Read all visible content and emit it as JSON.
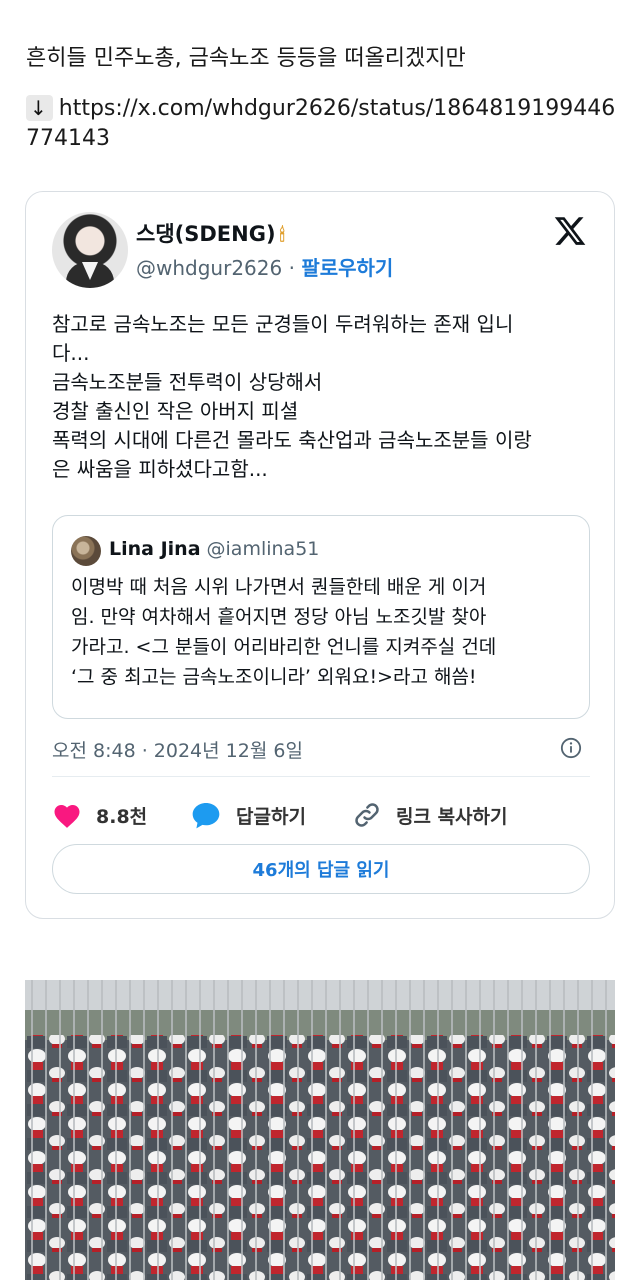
{
  "intro_text": "흔히들 민주노총, 금속노조 등등을 떠올리겠지만",
  "link": {
    "arrow": "↓",
    "url": "https://x.com/whdgur2626/status/1864819199446774143"
  },
  "tweet": {
    "name": "스댕(SDENG)",
    "name_emoji": "🕯",
    "handle": "@whdgur2626",
    "separator": "·",
    "follow_label": "팔로우하기",
    "logo": "x-logo-icon",
    "text_lines": [
      "참고로 금속노조는 모든 군경들이 두려워하는 존재 입니",
      "다...",
      "금속노조분들 전투력이 상당해서",
      "경찰 출신인 작은 아버지 피셜",
      "폭력의 시대에 다른건 몰라도 축산업과 금속노조분들 이랑",
      "은 싸움을 피하셨다고함..."
    ],
    "quote": {
      "name": "Lina Jina",
      "handle": "@iamlina51",
      "text_lines": [
        "이명박 때 처음 시위 나가면서 퀀들한테 배운 게 이거",
        "임. 만약 여차해서 흩어지면 정당 아님 노조깃발 찾아",
        "가라고. <그 분들이 어리바리한 언니를 지켜주실 건데",
        "‘그 중 최고는 금속노조이니라’ 외워요!>라고 해씀!"
      ]
    },
    "timestamp": "오전 8:48 · 2024년 12월 6일",
    "likes": "8.8천",
    "reply_label": "답글하기",
    "copy_link_label": "링크 복사하기",
    "read_replies_label": "46개의 답글 읽기"
  },
  "colors": {
    "like": "#f91880",
    "reply": "#1d9bf0",
    "accent_link": "#1d7bd9",
    "secondary_text": "#536471"
  }
}
